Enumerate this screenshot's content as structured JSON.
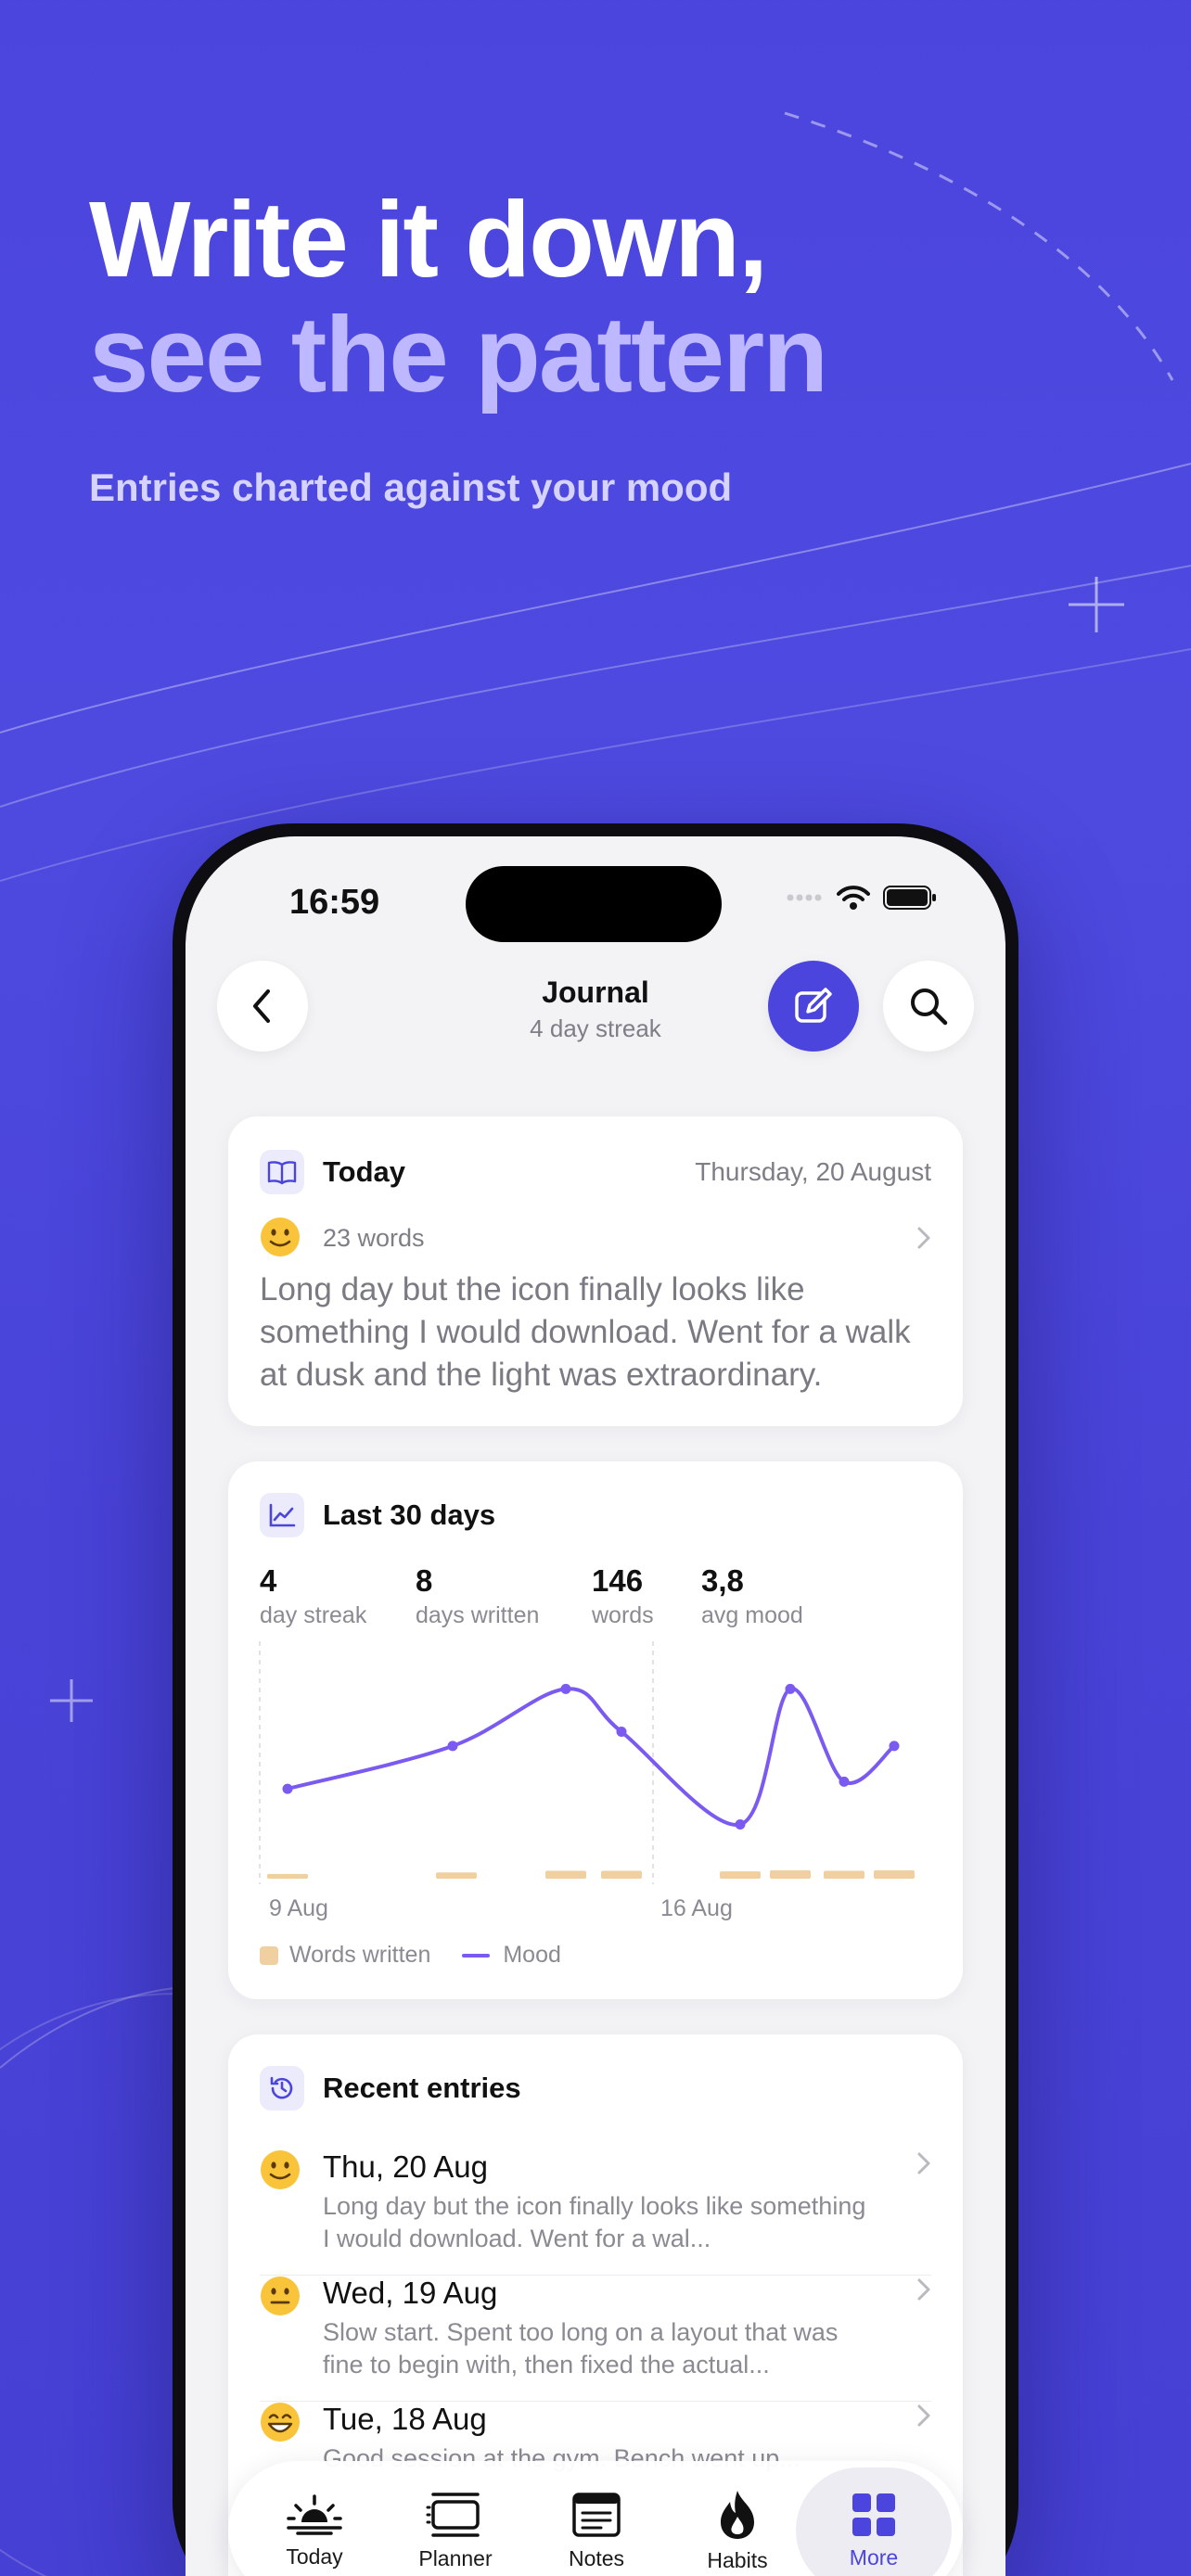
{
  "headline": {
    "line1": "Write it down,",
    "line2": "see the pattern"
  },
  "subheadline": "Entries charted against your mood",
  "status_bar": {
    "time": "16:59"
  },
  "nav": {
    "title": "Journal",
    "subtitle": "4 day streak",
    "back_icon": "chevron-left-icon",
    "compose_icon": "compose-icon",
    "search_icon": "search-icon"
  },
  "today_card": {
    "title": "Today",
    "date": "Thursday, 20 August",
    "word_count": "23 words",
    "mood_emoji": "slight-smile",
    "text": "Long day but the icon finally looks like something I would download. Went for a walk at dusk and the light was extraordinary."
  },
  "stats_card": {
    "title": "Last 30 days",
    "stats": [
      {
        "value": "4",
        "label": "day streak"
      },
      {
        "value": "8",
        "label": "days written"
      },
      {
        "value": "146",
        "label": "words"
      },
      {
        "value": "3,8",
        "label": "avg mood"
      }
    ],
    "legend": {
      "words": "Words written",
      "mood": "Mood"
    }
  },
  "chart_data": {
    "type": "line",
    "x_tick_labels": [
      "9 Aug",
      "16 Aug"
    ],
    "series": [
      {
        "name": "Mood",
        "type": "line",
        "color": "#7A5AF0",
        "values": [
          3.2,
          3.8,
          4.6,
          4.0,
          2.7,
          4.6,
          3.3,
          3.8
        ]
      },
      {
        "name": "Words written",
        "type": "bar",
        "color": "#F0CFA0",
        "values": [
          10,
          25,
          40,
          40,
          35,
          45,
          40,
          45
        ]
      }
    ],
    "grid": false,
    "legend_position": "bottom-left"
  },
  "recent_card": {
    "title": "Recent entries",
    "entries": [
      {
        "date": "Thu, 20 Aug",
        "emoji": "slight-smile",
        "snippet": "Long day but the icon finally looks like something I would download. Went for a wal..."
      },
      {
        "date": "Wed, 19 Aug",
        "emoji": "neutral",
        "snippet": "Slow start. Spent too long on a layout that was fine to begin with, then fixed the actual..."
      },
      {
        "date": "Tue, 18 Aug",
        "emoji": "grin",
        "snippet": "Good session at the gym. Bench went up..."
      }
    ]
  },
  "tabbar": {
    "tabs": [
      {
        "label": "Today",
        "icon": "sunrise-icon"
      },
      {
        "label": "Planner",
        "icon": "planner-icon"
      },
      {
        "label": "Notes",
        "icon": "notes-icon"
      },
      {
        "label": "Habits",
        "icon": "flame-icon"
      },
      {
        "label": "More",
        "icon": "grid-icon"
      }
    ],
    "active": "More",
    "active_color": "#4B45DD"
  },
  "colors": {
    "background": "#4B45DD",
    "accent": "#4B45DD",
    "headline_secondary": "#BDB8FF",
    "mood_line": "#7A5AF0",
    "words_bar": "#F0CFA0"
  }
}
